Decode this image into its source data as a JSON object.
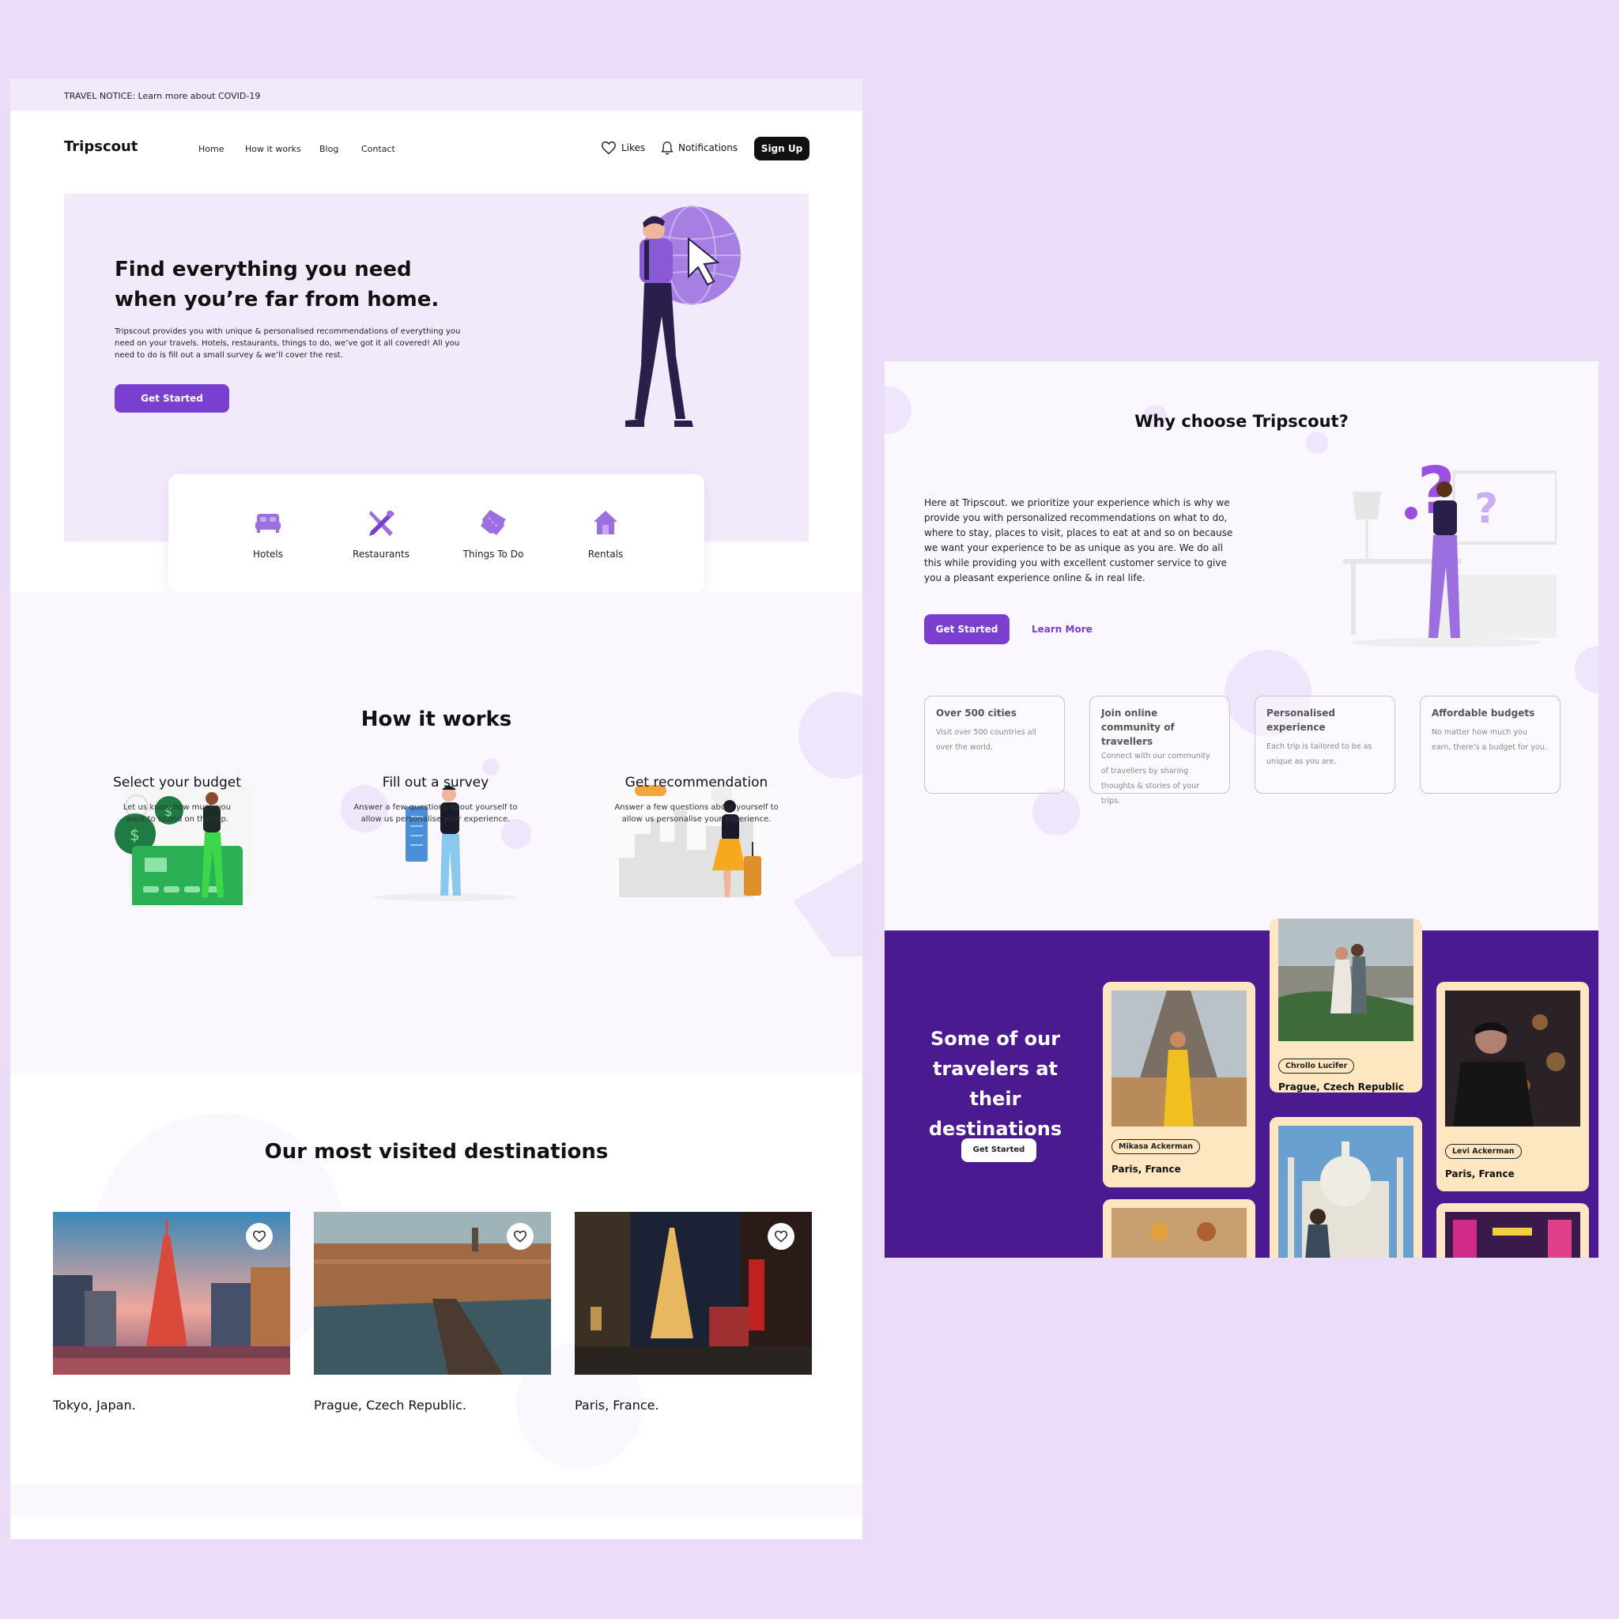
{
  "notice": "TRAVEL NOTICE: Learn more about COVID-19",
  "brand": "Tripscout",
  "nav": [
    "Home",
    "How it works",
    "Blog",
    "Contact"
  ],
  "likes": "Likes",
  "notifications": "Notifications",
  "signup": "Sign Up",
  "hero": {
    "title": "Find everything you need when you’re far from home.",
    "desc": "Tripscout provides you with unique & personalised recommendations of everything you need on your travels. Hotels, restaurants, things to do, we’ve got it all covered! All you need to do is fill out a small survey & we’ll cover the rest.",
    "cta": "Get Started"
  },
  "categories": [
    "Hotels",
    "Restaurants",
    "Things To Do",
    "Rentals"
  ],
  "how": {
    "title": "How it works",
    "steps": [
      {
        "title": "Select your budget",
        "desc": "Let us know how much you want to spend on the trip."
      },
      {
        "title": "Fill out a survey",
        "desc": "Answer a few questions about yourself to allow us personalise your experience."
      },
      {
        "title": "Get recommendation",
        "desc": "Answer a few questions about yourself to allow us personalise your experience."
      }
    ]
  },
  "destinations": {
    "title": "Our most visited destinations",
    "items": [
      "Tokyo, Japan.",
      "Prague, Czech Republic.",
      "Paris, France."
    ]
  },
  "why": {
    "title": "Why choose Tripscout?",
    "desc": "Here at Tripscout. we prioritize your experience which is why we provide you with personalized recommendations on what to do, where to stay, places to visit, places to eat at and so on because we want your experience to be as unique as you are. We do all this while  providing you with excellent customer service to give you a pleasant experience online & in real life.",
    "cta": "Get Started",
    "learn": "Learn More",
    "features": [
      {
        "title": "Over 500 cities",
        "desc": "Visit over 500 countries all over the world."
      },
      {
        "title": "Join online community of travellers",
        "desc": "Connect with our community of travellers by sharing thoughts & stories of your trips."
      },
      {
        "title": "Personalised experience",
        "desc": "Each trip is tailored to be as unique as you are."
      },
      {
        "title": "Affordable budgets",
        "desc": "No matter how much you earn, there’s a budget for you."
      }
    ]
  },
  "travelers": {
    "title": "Some of our travelers at their destinations",
    "cta": "Get Started",
    "cards": [
      {
        "name": "Mikasa Ackerman",
        "place": "Paris, France"
      },
      {
        "name": "Chrollo Lucifer",
        "place": "Prague, Czech Republic"
      },
      {
        "name": "Levi Ackerman",
        "place": "Paris, France"
      }
    ]
  },
  "colors": {
    "accent": "#7b3fd0",
    "dark_purple": "#4b1a91",
    "hero_bg": "#f2eafb",
    "card_bg": "#fde6c0",
    "page_bg": "#ebdcf8"
  }
}
